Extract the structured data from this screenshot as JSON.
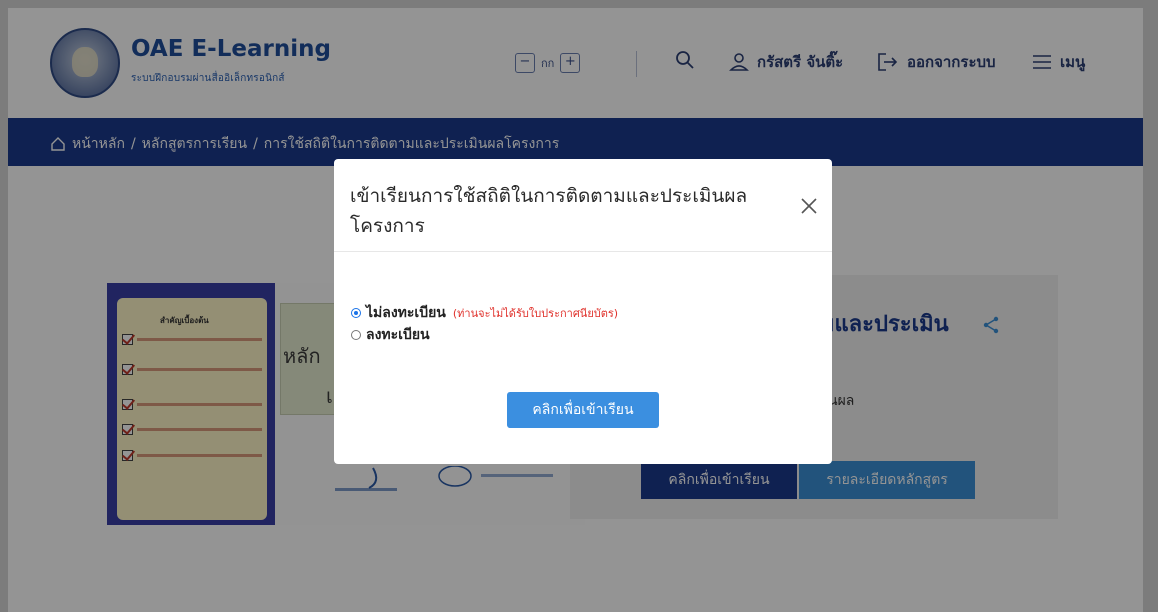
{
  "header": {
    "brand_title": "OAE E-Learning",
    "brand_subtitle": "ระบบฝึกอบรมผ่านสื่ออิเล็กทรอนิกส์",
    "font_size_label": "กก",
    "font_decrease": "−",
    "font_increase": "+",
    "user_name": "กรัสตรี จันติ๊ะ",
    "logout_label": "ออกจากระบบ",
    "menu_label": "เมนู"
  },
  "breadcrumb": {
    "home": "หน้าหลัก",
    "sep": "/",
    "courses": "หลักสูตรการเรียน",
    "current": "การใช้สถิติในการติดตามและประเมินผลโครงการ"
  },
  "course_card": {
    "title_partial": "มและประเมิน",
    "desc_partial": "นผล",
    "enroll_label": "คลิกเพื่อเข้าเรียน",
    "detail_label": "รายละเอียดหลักสูตร"
  },
  "thumbnail": {
    "paper_heading": "สำคัญเบื้องต้น",
    "text_partial": "หลัก",
    "text_partial_2": "เ"
  },
  "modal": {
    "title": "เข้าเรียนการใช้สถิติในการติดตามและประเมินผลโครงการ",
    "option_no_register": "ไม่ลงทะเบียน",
    "option_no_register_note": "(ท่านจะไม่ได้รับใบประกาศนียบัตร)",
    "option_register": "ลงทะเบียน",
    "selected_option": "ไม่ลงทะเบียน",
    "submit_label": "คลิกเพื่อเข้าเรียน"
  },
  "colors": {
    "navy": "#1b3a8c",
    "brand_blue": "#1f4e9b",
    "button_blue": "#3b8fe0",
    "note_red": "#e0322c"
  },
  "icons": [
    "home-icon",
    "search-icon",
    "user-icon",
    "logout-icon",
    "menu-icon",
    "share-icon",
    "close-icon"
  ]
}
